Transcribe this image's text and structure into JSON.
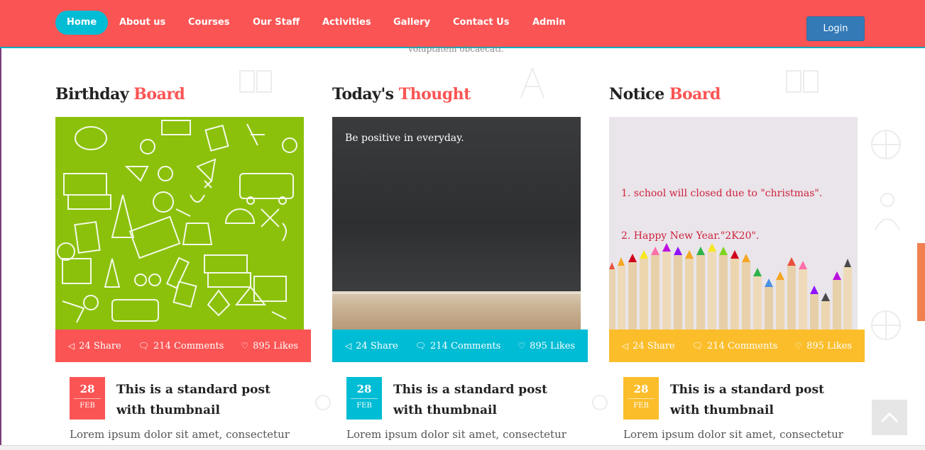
{
  "nav": {
    "items": [
      "Home",
      "About us",
      "Courses",
      "Our Staff",
      "Activities",
      "Gallery",
      "Contact Us",
      "Admin"
    ],
    "login": "Login"
  },
  "cut_text": "voluptatem obcaecati.",
  "columns": [
    {
      "title_main": "Birthday",
      "title_accent": "Board",
      "bar_color": "#fb5454",
      "share": "24 Share",
      "comments": "214 Comments",
      "likes": "895 Likes",
      "day": "28",
      "month": "FEB",
      "post_title": "This is a standard post with thumbnail",
      "excerpt": "Lorem ipsum dolor sit amet, consectetur"
    },
    {
      "title_main": "Today's",
      "title_accent": "Thought",
      "bar_color": "#00bcd4",
      "image_text": "Be positive in everyday.",
      "share": "24 Share",
      "comments": "214 Comments",
      "likes": "895 Likes",
      "day": "28",
      "month": "FEB",
      "post_title": "This is a standard post with thumbnail",
      "excerpt": "Lorem ipsum dolor sit amet, consectetur"
    },
    {
      "title_main": "Notice",
      "title_accent": "Board",
      "bar_color": "#fbbd2a",
      "notices": [
        "1. school will closed due to \"christmas\".",
        "2. Happy New Year.\"2K20\"."
      ],
      "share": "24 Share",
      "comments": "214 Comments",
      "likes": "895 Likes",
      "day": "28",
      "month": "FEB",
      "post_title": "This is a standard post with thumbnail",
      "excerpt": "Lorem ipsum dolor sit amet, consectetur"
    }
  ],
  "colors": {
    "nav_bg": "#fb5454",
    "active_tab": "#00bcd4",
    "login_btn": "#337ab7",
    "accent_text": "#fb5454"
  },
  "icons": [
    "share-icon",
    "comment-icon",
    "heart-icon",
    "chevron-up-icon"
  ]
}
